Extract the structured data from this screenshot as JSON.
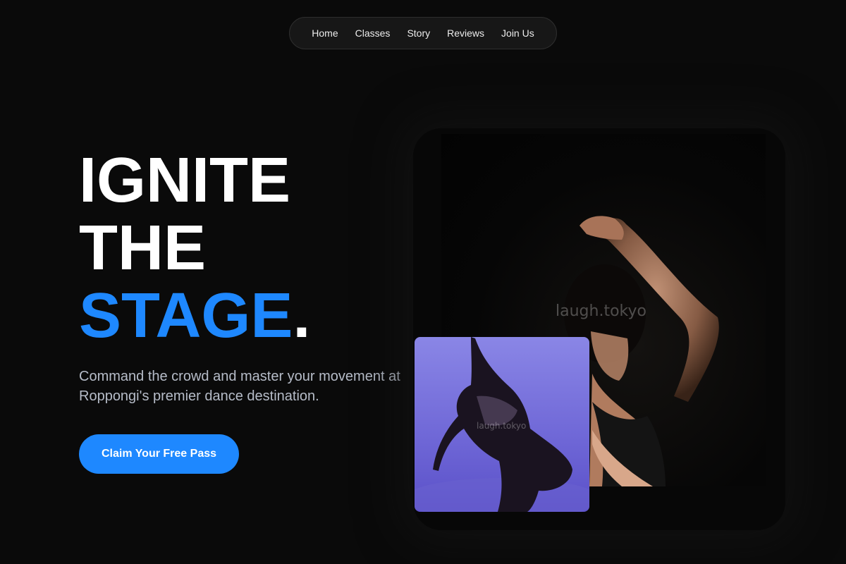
{
  "nav": {
    "items": [
      {
        "label": "Home"
      },
      {
        "label": "Classes"
      },
      {
        "label": "Story"
      },
      {
        "label": "Reviews"
      },
      {
        "label": "Join Us"
      }
    ]
  },
  "hero": {
    "line1": "IGNITE",
    "line2": "THE",
    "line3": "STAGE",
    "line3_punct": ".",
    "subtitle": "Command the crowd and master your movement at Roppongi's premier dance destination.",
    "cta_label": "Claim Your Free Pass"
  },
  "images": {
    "main_watermark": "laugh.tokyo",
    "small_watermark": "laugh.tokyo"
  },
  "colors": {
    "background": "#0a0a0a",
    "accent": "#1e88ff",
    "subtitle": "#b6bcc8"
  }
}
